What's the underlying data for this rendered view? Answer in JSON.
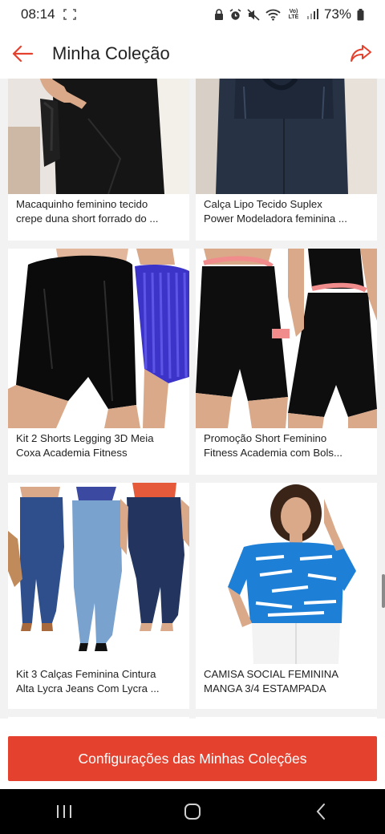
{
  "status_bar": {
    "time": "08:14",
    "network_label": "Vo) LTE",
    "battery_percent": "73%"
  },
  "header": {
    "title": "Minha Coleção"
  },
  "products": [
    {
      "line1": "Macaquinho feminino tecido",
      "line2": "crepe duna short forrado do ...",
      "image": "black-romper-photo"
    },
    {
      "line1": "Calça Lipo Tecido Suplex",
      "line2": "Power Modeladora feminina ...",
      "image": "shaping-leggings-photo"
    },
    {
      "line1": "Kit 2 Shorts Legging 3D Meia",
      "line2": "Coxa Academia Fitness",
      "image": "black-blue-shorts-photo"
    },
    {
      "line1": "Promoção Short Feminino",
      "line2": "Fitness Academia com Bols...",
      "image": "black-pink-fitness-shorts-photo"
    },
    {
      "line1": "Kit 3 Calças Feminina Cintura",
      "line2": "Alta Lycra Jeans Com Lycra ...",
      "image": "three-jeans-photo"
    },
    {
      "line1": "CAMISA SOCIAL FEMININA",
      "line2": "MANGA 3/4 ESTAMPADA",
      "image": "blue-printed-blouse-photo"
    }
  ],
  "bottom_button": {
    "label": "Configurações das Minhas Coleções"
  },
  "colors": {
    "accent": "#e4412f",
    "background": "#f2f2f2"
  }
}
